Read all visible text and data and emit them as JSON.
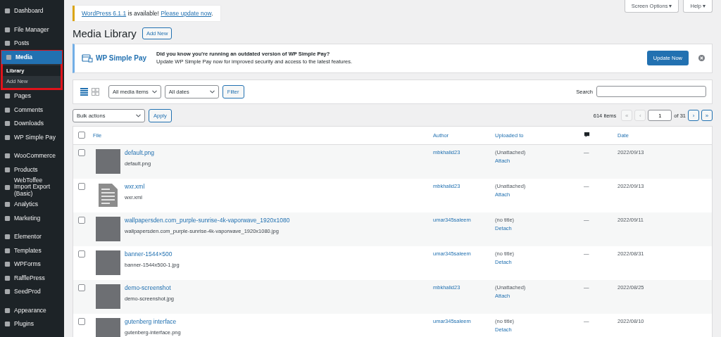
{
  "sidebar": {
    "groups": [
      {
        "items": [
          {
            "label": "Dashboard",
            "selected": false
          }
        ]
      },
      {
        "items": [
          {
            "label": "File Manager",
            "selected": false
          },
          {
            "label": "Posts",
            "selected": false
          },
          {
            "label": "Media",
            "selected": true,
            "highlighted": true,
            "submenu": [
              {
                "label": "Library",
                "selected": true
              },
              {
                "label": "Add New",
                "selected": false
              }
            ]
          },
          {
            "label": "Pages",
            "selected": false
          },
          {
            "label": "Comments",
            "selected": false
          },
          {
            "label": "Downloads",
            "selected": false
          },
          {
            "label": "WP Simple Pay",
            "selected": false
          }
        ]
      },
      {
        "items": [
          {
            "label": "WooCommerce",
            "selected": false
          },
          {
            "label": "Products",
            "selected": false
          },
          {
            "label": "WebToffee Import Export (Basic)",
            "selected": false
          },
          {
            "label": "Analytics",
            "selected": false
          },
          {
            "label": "Marketing",
            "selected": false
          }
        ]
      },
      {
        "items": [
          {
            "label": "Elementor",
            "selected": false
          },
          {
            "label": "Templates",
            "selected": false
          },
          {
            "label": "WPForms",
            "selected": false
          },
          {
            "label": "RafflePress",
            "selected": false
          },
          {
            "label": "SeedProd",
            "selected": false
          }
        ]
      },
      {
        "items": [
          {
            "label": "Appearance",
            "selected": false
          },
          {
            "label": "Plugins",
            "selected": false
          }
        ]
      }
    ]
  },
  "top_buttons": [
    "Screen Options ▾",
    "Help ▾"
  ],
  "update_notice": {
    "link1": "WordPress 6.1.1",
    "middle": " is available! ",
    "link2": "Please update now",
    "end": "."
  },
  "page_title": "Media Library",
  "add_new": "Add New",
  "promo": {
    "logo": "WP Simple Pay",
    "headline": "Did you know you're running an outdated version of WP Simple Pay?",
    "text": "Update WP Simple Pay now for improved security and access to the latest features.",
    "button": "Update Now"
  },
  "filter_bar": {
    "views": [
      {
        "kind": "list",
        "selected": true
      },
      {
        "kind": "grid",
        "selected": false
      }
    ],
    "media_select": "All media items",
    "date_select": "All dates",
    "filter": "Filter",
    "search_label": "Search"
  },
  "bulk": {
    "select": "Bulk actions",
    "apply": "Apply"
  },
  "pagination": {
    "count": "614 items",
    "first": "«",
    "prev": "‹",
    "page": "1",
    "of": "of 31",
    "next": "›",
    "last": "»"
  },
  "table": {
    "select_all_checked": false,
    "columns": [
      "File",
      "Author",
      "Uploaded to",
      "Date"
    ],
    "rows": [
      {
        "checked": false,
        "kind": "image",
        "title": "default.png",
        "filename": "default.png",
        "author": "mbkhalid23",
        "uploaded_to": "(Unattached)",
        "action": "Attach",
        "comments": "—",
        "date": "2022/09/13"
      },
      {
        "checked": false,
        "kind": "document",
        "title": "wxr.xml",
        "filename": "wxr.xml",
        "author": "mbkhalid23",
        "uploaded_to": "(Unattached)",
        "action": "Attach",
        "comments": "—",
        "date": "2022/09/13"
      },
      {
        "checked": false,
        "kind": "image",
        "title": "wallpapersden.com_purple-sunrise-4k-vaporwave_1920x1080",
        "filename": "wallpapersden.com_purple-sunrise-4k-vaporwave_1920x1080.jpg",
        "author": "umar345saleem",
        "uploaded_to": "(no title)",
        "action": "Detach",
        "comments": "—",
        "date": "2022/09/11"
      },
      {
        "checked": false,
        "kind": "image",
        "title": "banner-1544×500",
        "filename": "banner-1544x500-1.jpg",
        "author": "umar345saleem",
        "uploaded_to": "(no title)",
        "action": "Detach",
        "comments": "—",
        "date": "2022/08/31"
      },
      {
        "checked": false,
        "kind": "image",
        "title": "demo-screenshot",
        "filename": "demo-screenshot.jpg",
        "author": "mbkhalid23",
        "uploaded_to": "(Unattached)",
        "action": "Attach",
        "comments": "—",
        "date": "2022/08/25"
      },
      {
        "checked": false,
        "kind": "image",
        "title": "gutenberg interface",
        "filename": "gutenberg-interface.png",
        "author": "umar345saleem",
        "uploaded_to": "(no title)",
        "action": "Detach",
        "comments": "—",
        "date": "2022/08/10"
      }
    ]
  }
}
